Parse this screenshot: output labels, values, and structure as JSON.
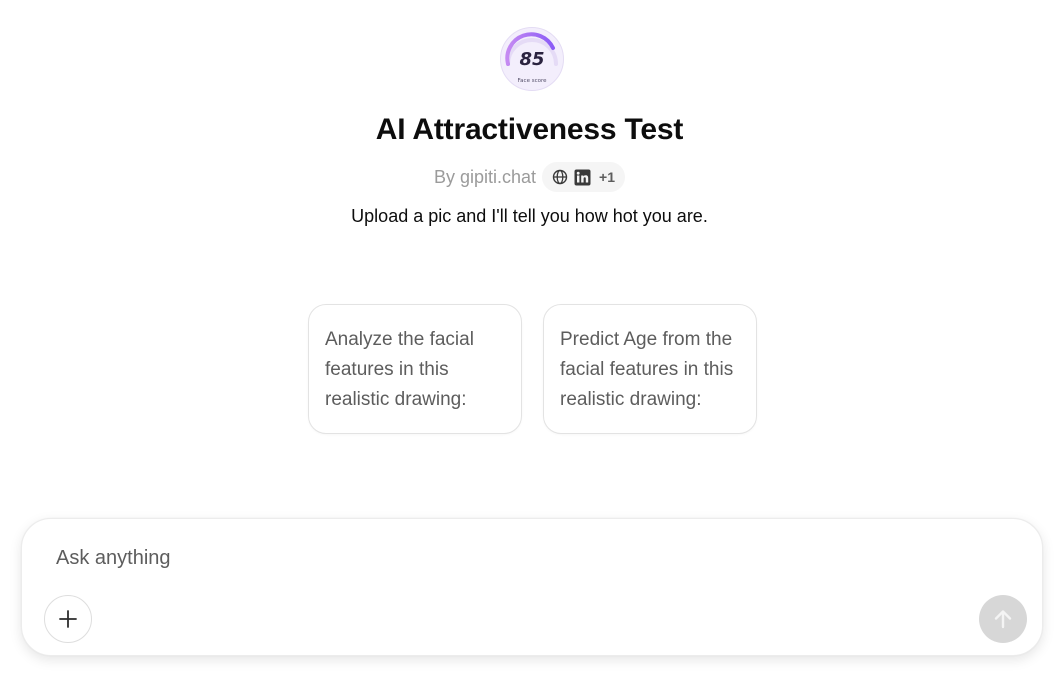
{
  "gpt": {
    "avatar": {
      "score": "85",
      "caption": "Face score",
      "icon": "face-score-gauge-icon",
      "accent": "#a36be6",
      "background": "#f1ecfb"
    },
    "title": "AI Attractiveness Test",
    "byline": "By gipiti.chat",
    "social": {
      "icons": [
        "globe-icon",
        "linkedin-icon"
      ],
      "more_count": "+1"
    },
    "description": "Upload a pic and I'll tell you how hot you are."
  },
  "starters": [
    {
      "text": "Analyze the facial features in this realistic drawing:"
    },
    {
      "text": "Predict Age from the facial features in this realistic drawing:"
    }
  ],
  "composer": {
    "placeholder": "Ask anything",
    "attach_icon": "plus-icon",
    "send_icon": "arrow-up-icon",
    "send_color": "#d7d7d7"
  }
}
